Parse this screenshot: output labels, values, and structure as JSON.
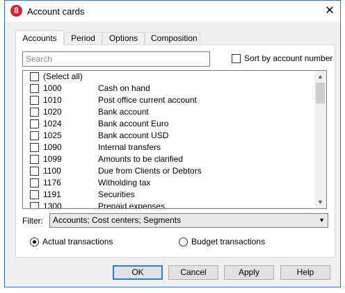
{
  "window": {
    "title": "Account cards",
    "app_icon": "8",
    "close_glyph": "✕"
  },
  "tabs": [
    {
      "label": "Accounts"
    },
    {
      "label": "Period"
    },
    {
      "label": "Options"
    },
    {
      "label": "Composition"
    }
  ],
  "search": {
    "placeholder": "Search",
    "value": ""
  },
  "sort_by_number": {
    "label": "Sort by account number",
    "checked": false
  },
  "accounts": [
    {
      "number": "(Select all)",
      "name": ""
    },
    {
      "number": "1000",
      "name": "Cash on hand"
    },
    {
      "number": "1010",
      "name": "Post office current account"
    },
    {
      "number": "1020",
      "name": "Bank account"
    },
    {
      "number": "1024",
      "name": "Bank account Euro"
    },
    {
      "number": "1025",
      "name": "Bank account USD"
    },
    {
      "number": "1090",
      "name": "Internal transfers"
    },
    {
      "number": "1099",
      "name": "Amounts to be clarified"
    },
    {
      "number": "1100",
      "name": "Due from Clients or Debtors"
    },
    {
      "number": "1176",
      "name": "Witholding tax"
    },
    {
      "number": "1191",
      "name": "Securities"
    },
    {
      "number": "1300",
      "name": "Prepaid expenses"
    }
  ],
  "filter": {
    "label": "Filter:",
    "value": "Accounts; Cost centers; Segments"
  },
  "transactions": {
    "actual_label": "Actual transactions",
    "budget_label": "Budget transactions",
    "selected": "actual"
  },
  "buttons": {
    "ok": "OK",
    "cancel": "Cancel",
    "apply": "Apply",
    "help": "Help"
  },
  "colors": {
    "accent": "#2b79d6",
    "icon_red": "#d81e2c"
  },
  "icons": {
    "app": "banana-app-icon",
    "close": "close-icon",
    "scroll_up": "chevron-up-icon",
    "scroll_down": "chevron-down-icon",
    "dropdown": "dropdown-arrow-icon"
  }
}
